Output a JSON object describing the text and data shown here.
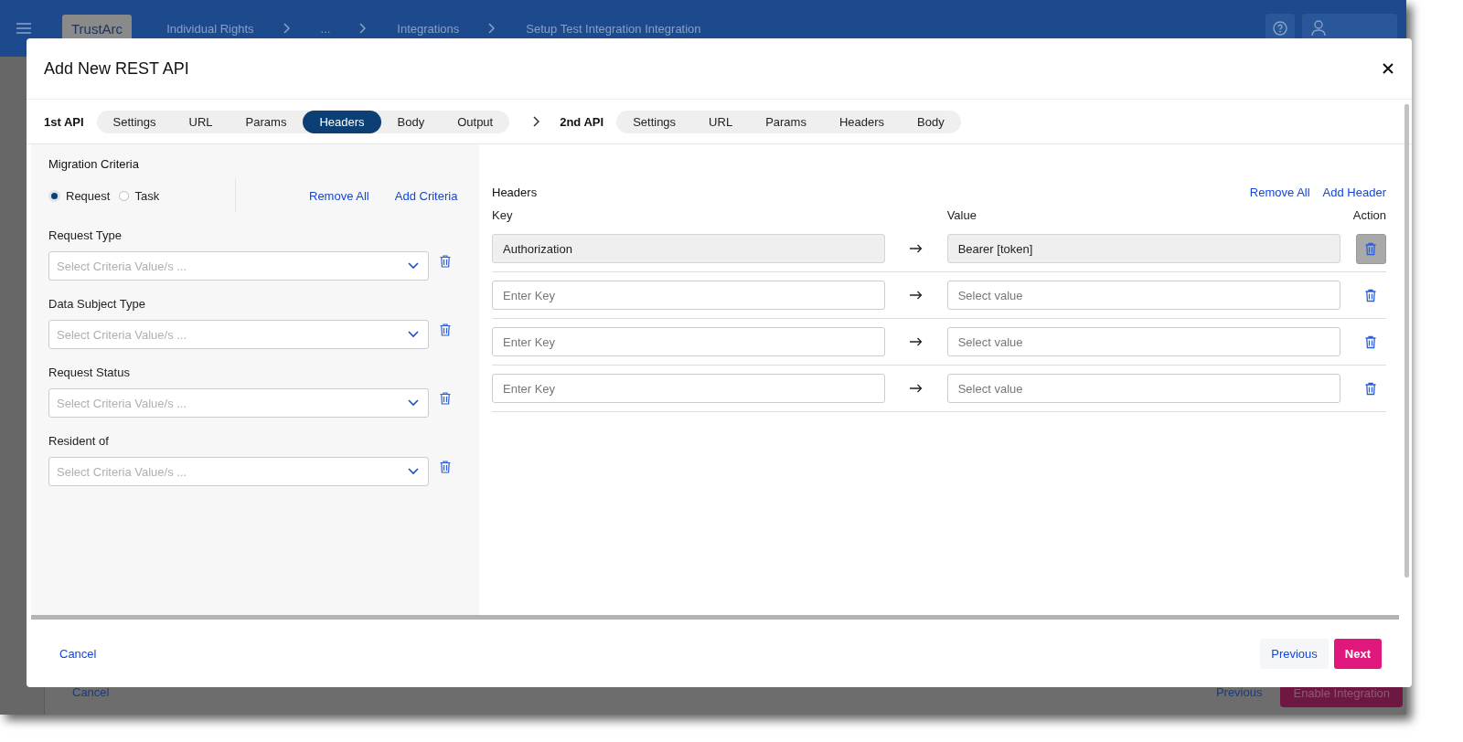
{
  "app_bar": {
    "logo": "TrustArc",
    "breadcrumbs": [
      {
        "label": "Individual Rights"
      },
      {
        "label": "..."
      },
      {
        "label": "Integrations"
      },
      {
        "label": "Setup Test Integration Integration"
      }
    ]
  },
  "background_footer": {
    "cancel": "Cancel",
    "previous": "Previous",
    "primary": "Enable Integration"
  },
  "dialog": {
    "title": "Add New REST API",
    "api_groups": [
      {
        "label": "1st API",
        "tabs": [
          {
            "label": "Settings",
            "selected": false
          },
          {
            "label": "URL",
            "selected": false
          },
          {
            "label": "Params",
            "selected": false
          },
          {
            "label": "Headers",
            "selected": true
          },
          {
            "label": "Body",
            "selected": false
          },
          {
            "label": "Output",
            "selected": false
          }
        ]
      },
      {
        "label": "2nd API",
        "tabs": [
          {
            "label": "Settings",
            "selected": false
          },
          {
            "label": "URL",
            "selected": false
          },
          {
            "label": "Params",
            "selected": false
          },
          {
            "label": "Headers",
            "selected": false
          },
          {
            "label": "Body",
            "selected": false
          }
        ]
      }
    ],
    "criteria": {
      "title": "Migration Criteria",
      "modes": [
        {
          "label": "Request",
          "selected": true
        },
        {
          "label": "Task",
          "selected": false
        }
      ],
      "remove_all": "Remove All",
      "add": "Add Criteria",
      "fields": [
        {
          "label": "Request Type",
          "placeholder": "Select Criteria Value/s ..."
        },
        {
          "label": "Data Subject Type",
          "placeholder": "Select Criteria Value/s ..."
        },
        {
          "label": "Request Status",
          "placeholder": "Select Criteria Value/s ..."
        },
        {
          "label": "Resident of",
          "placeholder": "Select Criteria Value/s ..."
        }
      ]
    },
    "headers": {
      "title": "Headers",
      "remove_all": "Remove All",
      "add": "Add Header",
      "columns": {
        "key": "Key",
        "value": "Value",
        "action": "Action"
      },
      "rows": [
        {
          "key": "Authorization",
          "value": "Bearer [token]",
          "disabled": true
        },
        {
          "key_placeholder": "Enter Key",
          "value_placeholder": "Select value",
          "disabled": false
        },
        {
          "key_placeholder": "Enter Key",
          "value_placeholder": "Select value",
          "disabled": false
        },
        {
          "key_placeholder": "Enter Key",
          "value_placeholder": "Select value",
          "disabled": false
        }
      ]
    },
    "footer": {
      "cancel": "Cancel",
      "previous": "Previous",
      "next": "Next"
    }
  }
}
